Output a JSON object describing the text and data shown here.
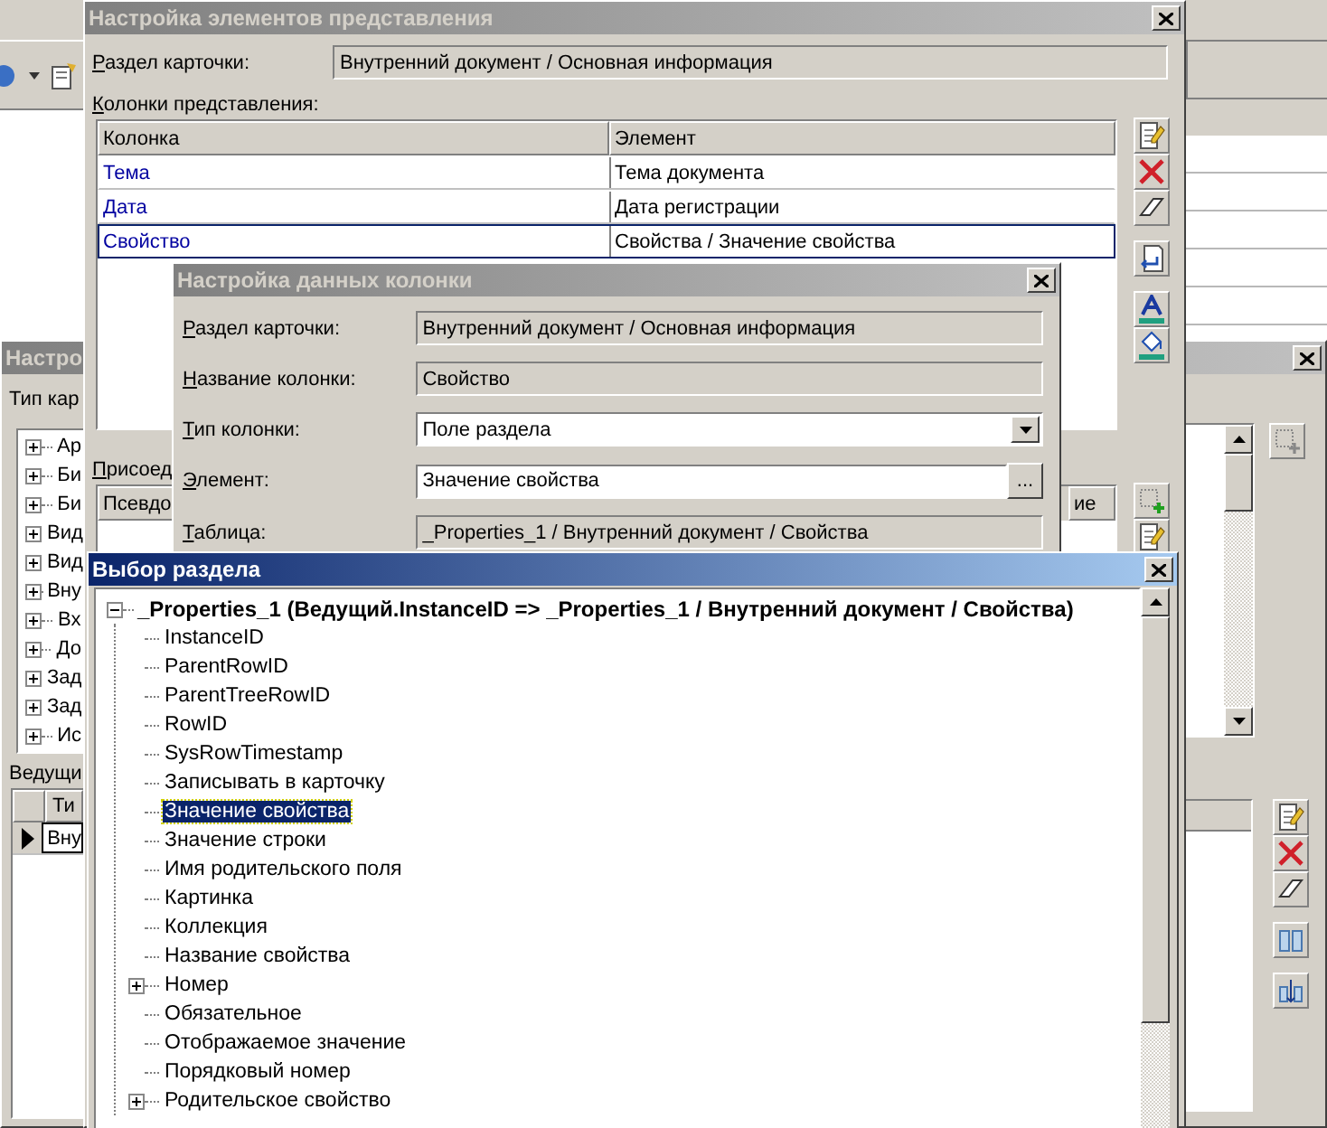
{
  "background_window": {
    "title": "Настро",
    "type_label": "Тип кар",
    "tree": [
      {
        "label": "Ар",
        "expanded": false
      },
      {
        "label": "Би",
        "expanded": false
      },
      {
        "label": "Би",
        "expanded": false
      },
      {
        "label": "Вид",
        "expanded": false
      },
      {
        "label": "Вид",
        "expanded": false
      },
      {
        "label": "Вну",
        "expanded": false
      },
      {
        "label": "Вх",
        "expanded": false
      },
      {
        "label": "До",
        "expanded": false
      },
      {
        "label": "Зад",
        "expanded": false
      },
      {
        "label": "Зад",
        "expanded": false
      },
      {
        "label": "Ис",
        "expanded": false
      }
    ],
    "lead_label": "Ведущи",
    "lead_table": {
      "columns": [
        "Ти"
      ],
      "rows": [
        {
          "cells": [
            "Вну"
          ],
          "selected": true
        }
      ]
    }
  },
  "elements_window": {
    "title": "Настройка элементов представления",
    "section_label": "Раздел карточки:",
    "section_value": "Внутренний документ / Основная информация",
    "columns_label": "Колонки представления:",
    "table": {
      "columns": [
        "Колонка",
        "Элемент"
      ],
      "rows": [
        {
          "cells": [
            "Тема",
            "Тема документа"
          ],
          "selected": false
        },
        {
          "cells": [
            "Дата",
            "Дата регистрации"
          ],
          "selected": false
        },
        {
          "cells": [
            "Свойство",
            "Свойства / Значение свойства"
          ],
          "selected": true
        }
      ]
    },
    "joins_label": "Присоед",
    "joins_table": {
      "columns": [
        "Псевдо",
        "ие"
      ]
    }
  },
  "column_window": {
    "title": "Настройка данных колонки",
    "fields": [
      {
        "label": "Раздел карточки:",
        "value": "Внутренний документ / Основная информация",
        "kind": "readonly"
      },
      {
        "label": "Название колонки:",
        "value": "Свойство",
        "kind": "readonly"
      },
      {
        "label": "Тип колонки:",
        "value": "Поле раздела",
        "kind": "dropdown"
      },
      {
        "label": "Элемент:",
        "value": "Значение свойства",
        "kind": "browse",
        "button_text": "..."
      },
      {
        "label": "Таблица:",
        "value": "_Properties_1 / Внутренний документ / Свойства",
        "kind": "readonly"
      }
    ]
  },
  "section_window": {
    "title": "Выбор раздела",
    "tree": [
      {
        "label": "_Properties_1 (Ведущий.InstanceID => _Properties_1 / Внутренний документ / Свойства)",
        "expanded": true,
        "children": [
          {
            "label": "InstanceID",
            "selected": false,
            "collapsed": false
          },
          {
            "label": "ParentRowID",
            "selected": false,
            "collapsed": false
          },
          {
            "label": "ParentTreeRowID",
            "selected": false,
            "collapsed": false
          },
          {
            "label": "RowID",
            "selected": false,
            "collapsed": false
          },
          {
            "label": "SysRowTimestamp",
            "selected": false,
            "collapsed": false
          },
          {
            "label": "Записывать в карточку",
            "selected": false,
            "collapsed": false
          },
          {
            "label": "Значение свойства",
            "selected": true,
            "collapsed": false
          },
          {
            "label": "Значение строки",
            "selected": false,
            "collapsed": false
          },
          {
            "label": "Имя родительского поля",
            "selected": false,
            "collapsed": false
          },
          {
            "label": "Картинка",
            "selected": false,
            "collapsed": false
          },
          {
            "label": "Коллекция",
            "selected": false,
            "collapsed": false
          },
          {
            "label": "Название свойства",
            "selected": false,
            "collapsed": false
          },
          {
            "label": "Номер",
            "selected": false,
            "collapsed": true
          },
          {
            "label": "Обязательное",
            "selected": false,
            "collapsed": false
          },
          {
            "label": "Отображаемое значение",
            "selected": false,
            "collapsed": false
          },
          {
            "label": "Порядковый номер",
            "selected": false,
            "collapsed": false
          },
          {
            "label": "Родительское свойство",
            "selected": false,
            "collapsed": true
          }
        ]
      }
    ]
  }
}
